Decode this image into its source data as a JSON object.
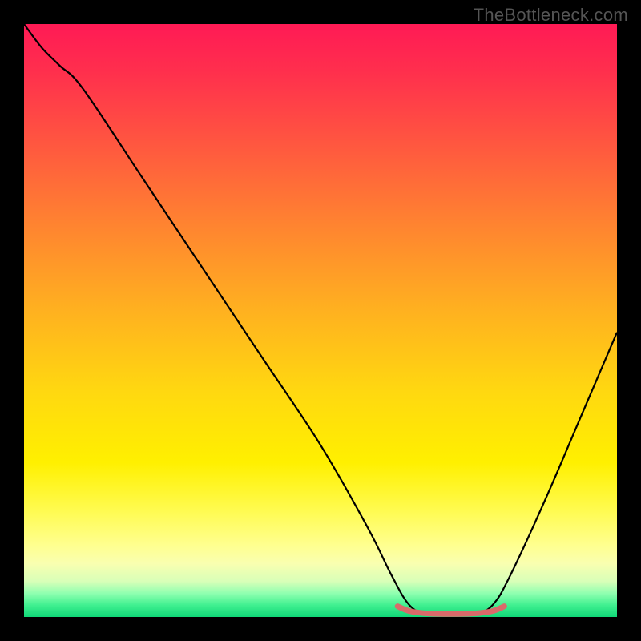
{
  "watermark": "TheBottleneck.com",
  "chart_data": {
    "type": "line",
    "title": "",
    "xlabel": "",
    "ylabel": "",
    "xlim": [
      0,
      100
    ],
    "ylim": [
      0,
      100
    ],
    "series": [
      {
        "name": "bottleneck-curve",
        "points": [
          {
            "x": 0,
            "y": 100
          },
          {
            "x": 3,
            "y": 96
          },
          {
            "x": 6,
            "y": 93
          },
          {
            "x": 10,
            "y": 89
          },
          {
            "x": 20,
            "y": 74
          },
          {
            "x": 30,
            "y": 59
          },
          {
            "x": 40,
            "y": 44
          },
          {
            "x": 50,
            "y": 29
          },
          {
            "x": 58,
            "y": 15
          },
          {
            "x": 62,
            "y": 7
          },
          {
            "x": 65,
            "y": 2
          },
          {
            "x": 68,
            "y": 0.5
          },
          {
            "x": 72,
            "y": 0.3
          },
          {
            "x": 76,
            "y": 0.5
          },
          {
            "x": 79,
            "y": 2
          },
          {
            "x": 82,
            "y": 7
          },
          {
            "x": 88,
            "y": 20
          },
          {
            "x": 94,
            "y": 34
          },
          {
            "x": 100,
            "y": 48
          }
        ]
      },
      {
        "name": "optimal-highlight",
        "points": [
          {
            "x": 63,
            "y": 1.8
          },
          {
            "x": 65,
            "y": 1.0
          },
          {
            "x": 68,
            "y": 0.6
          },
          {
            "x": 72,
            "y": 0.5
          },
          {
            "x": 76,
            "y": 0.6
          },
          {
            "x": 79,
            "y": 1.0
          },
          {
            "x": 81,
            "y": 1.8
          }
        ]
      }
    ],
    "colors": {
      "curve": "#000000",
      "highlight": "#d96a6a",
      "gradient_top": "#ff1a55",
      "gradient_bottom": "#10d878"
    }
  }
}
